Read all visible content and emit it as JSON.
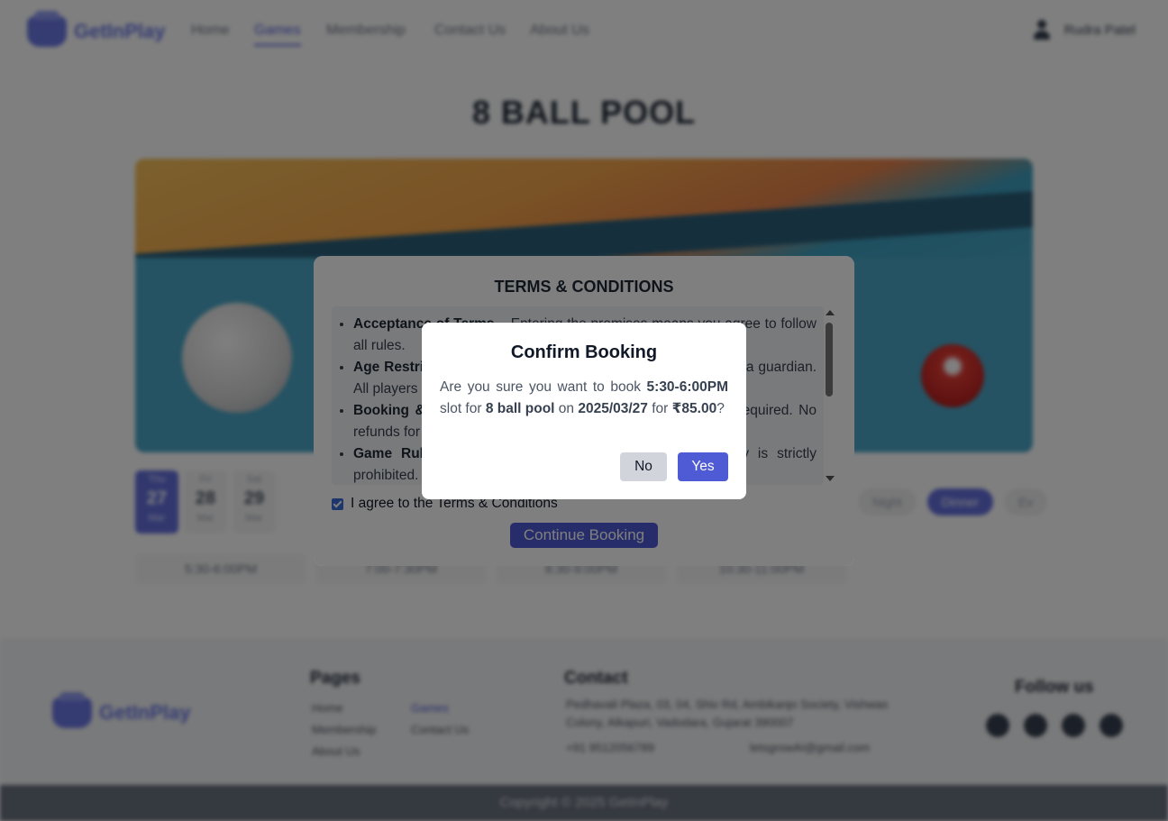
{
  "nav": {
    "brand": "GetInPlay",
    "links": [
      "Home",
      "Games",
      "Membership",
      "Contact Us",
      "About Us"
    ],
    "active_link": "Games",
    "user_name": "Rudra Patel"
  },
  "game": {
    "title": "8 BALL POOL"
  },
  "dates": [
    {
      "day": "Thu",
      "num": "27",
      "month": "Mar"
    },
    {
      "day": "Fri",
      "num": "28",
      "month": "Mar"
    },
    {
      "day": "Sat",
      "num": "29",
      "month": "Mar"
    }
  ],
  "periods": [
    "Night",
    "Dinner",
    "Ev"
  ],
  "active_period": "Dinner",
  "slots": [
    "5:30-6:00PM",
    "7:00-7:30PM",
    "8:30-9:00PM",
    "10:30-11:00PM"
  ],
  "terms": {
    "title": "TERMS & CONDITIONS",
    "items": [
      {
        "head": "Acceptance of Terms",
        "body": " – Entering the premises means you agree to follow all rules."
      },
      {
        "head": "Age Restriction",
        "body": " – Players under 12 must be accompanied by a guardian. All players play at their own risk."
      },
      {
        "head": "Booking & Payment",
        "body": " – Advance booking and payment are required. No refunds for missed slots."
      },
      {
        "head": "Game Rules",
        "body": " – Respect all players and staff. Rough play is strictly prohibited."
      }
    ],
    "agree_label": "I agree to the Terms & Conditions",
    "agree_checked": true,
    "continue_label": "Continue Booking"
  },
  "confirm": {
    "title": "Confirm Booking",
    "msg_prefix": "Are you sure you want to book ",
    "slot": "5:30-6:00PM",
    "msg_slot_for": " slot for ",
    "game": "8 ball pool",
    "msg_on": " on ",
    "date": "2025/03/27",
    "msg_for": " for ",
    "price": "₹85.00",
    "msg_end": "?",
    "no_label": "No",
    "yes_label": "Yes"
  },
  "footer": {
    "brand": "GetInPlay",
    "pages_title": "Pages",
    "pages": [
      "Home",
      "Games",
      "Membership",
      "Contact Us",
      "About Us"
    ],
    "contact_title": "Contact",
    "address": "Pedhavali Plaza, 03, 04, Shiv Rd, Ambikanjo Society, Vishwas Colony, Alkapuri, Vadodara, Gujarat 390007",
    "phone": "+91 9512056789",
    "email": "letsgrowAI@gmail.com",
    "follow_title": "Follow us",
    "socials": [
      "facebook-icon",
      "x-icon",
      "youtube-icon",
      "instagram-icon"
    ],
    "copyright": "Copyright © 2025 GetInPlay"
  },
  "colors": {
    "accent": "#4f5bd5",
    "overlay": "rgba(0,0,0,0.5)"
  }
}
